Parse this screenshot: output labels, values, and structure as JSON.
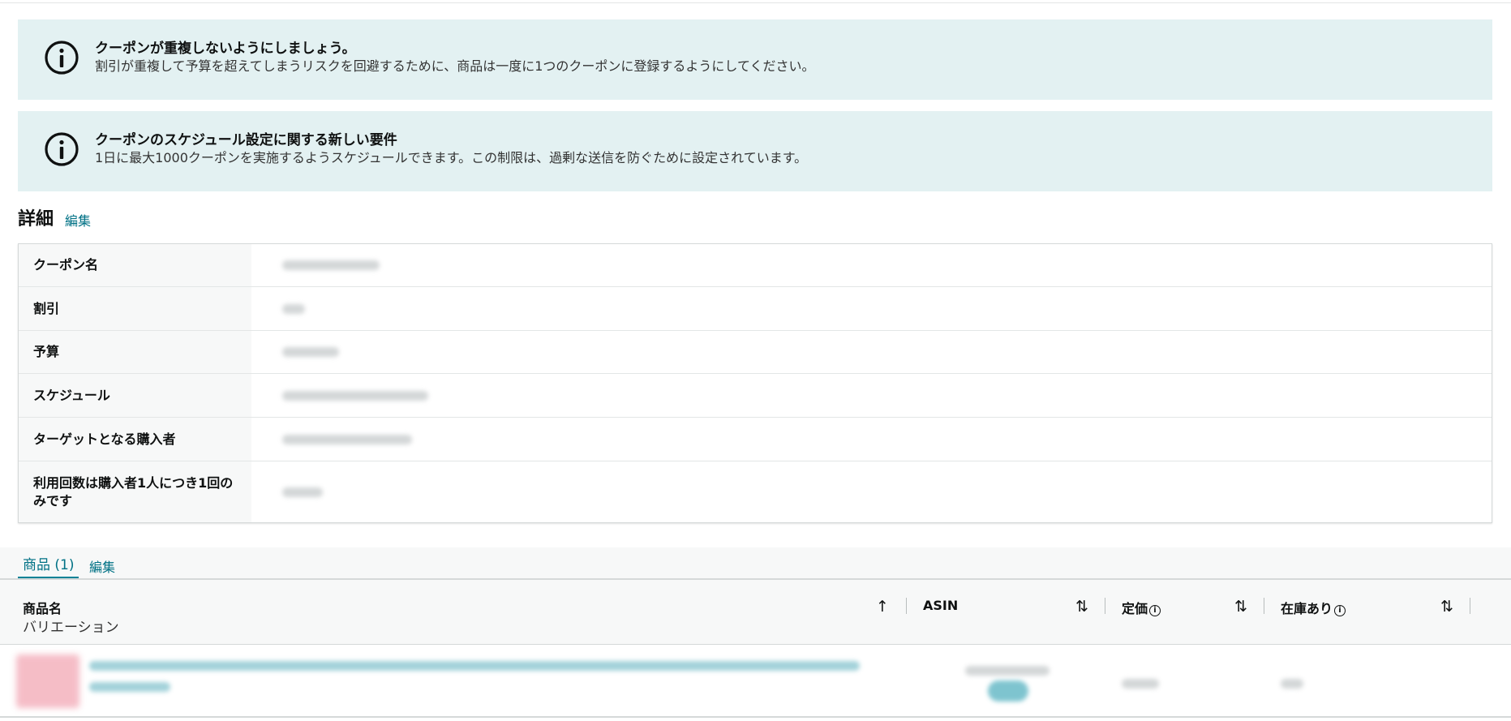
{
  "alerts": [
    {
      "title": "クーポンが重複しないようにしましょう。",
      "body": "割引が重複して予算を超えてしまうリスクを回避するために、商品は一度に1つのクーポンに登録するようにしてください。"
    },
    {
      "title": "クーポンのスケジュール設定に関する新しい要件",
      "body": "1日に最大1000クーポンを実施するようスケジュールできます。この制限は、過剰な送信を防ぐために設定されています。"
    }
  ],
  "details": {
    "heading": "詳細",
    "edit_label": "編集",
    "rows": [
      {
        "label": "クーポン名"
      },
      {
        "label": "割引"
      },
      {
        "label": "予算"
      },
      {
        "label": "スケジュール"
      },
      {
        "label": "ターゲットとなる購入者"
      },
      {
        "label": "利用回数は購入者1人につき1回のみです"
      }
    ]
  },
  "products": {
    "tab_label": "商品 (1)",
    "edit_label": "編集",
    "columns": {
      "name": "商品名",
      "variation": "バリエーション",
      "asin": "ASIN",
      "list_price": "定価",
      "in_stock": "在庫あり"
    }
  },
  "icons": {
    "info": "info-circle-icon",
    "sort_asc": "arrow-up-icon",
    "sort": "sort-arrows-icon"
  },
  "colors": {
    "alert_bg": "#e3f1f2",
    "link": "#007185",
    "tab_underline": "#008296"
  }
}
